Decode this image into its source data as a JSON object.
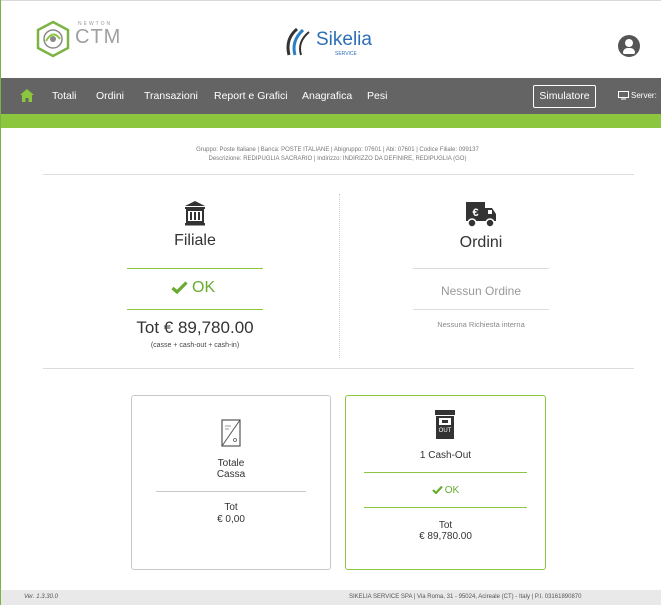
{
  "header": {
    "ctm_logo_small_text": "NEWTON",
    "ctm_logo_text": "CTM",
    "sikelia_logo_text": "Sikelia",
    "sikelia_logo_sub": "SERVICE"
  },
  "navbar": {
    "items": [
      {
        "label": "Totali"
      },
      {
        "label": "Ordini"
      },
      {
        "label": "Transazioni"
      },
      {
        "label": "Report e Grafici"
      },
      {
        "label": "Anagrafica"
      },
      {
        "label": "Pesi"
      }
    ],
    "simulatore_label": "Simulatore",
    "server_label": "Server:"
  },
  "info": {
    "line1": "Gruppo: Poste Italiane | Banca: POSTE ITALIANE | Abigruppo: 07601 | Abi: 07601 | Codice Filiale: 099137",
    "line2": "Descrizione: REDIPUGLIA SACRARIO | Indirizzo: INDIRIZZO DA DEFINIRE, REDIPUGLIA (GO)"
  },
  "filiale": {
    "title": "Filiale",
    "status": "OK",
    "total": "Tot € 89,780.00",
    "total_note": "(casse + cash-out + cash-in)"
  },
  "ordini": {
    "title": "Ordini",
    "status": "Nessun Ordine",
    "note": "Nessuna Richiesta interna"
  },
  "cassa_card": {
    "title_line1": "Totale",
    "title_line2": "Cassa",
    "tot_label": "Tot",
    "tot_value": "€ 0,00"
  },
  "cashout_card": {
    "title": "1 Cash-Out",
    "icon_text": "OUT",
    "status": "OK",
    "tot_label": "Tot",
    "tot_value": "€ 89,780.00"
  },
  "footer": {
    "version": "Ver. 1.3.30.0",
    "company": "SIKELIA SERVICE SPA | Via Roma, 31 - 95024, Acireale (CT) - Italy | P.I. 03161890870"
  },
  "colors": {
    "accent_green": "#8cc63f",
    "ok_green": "#6aab2f",
    "navbar_grey": "#646464"
  }
}
